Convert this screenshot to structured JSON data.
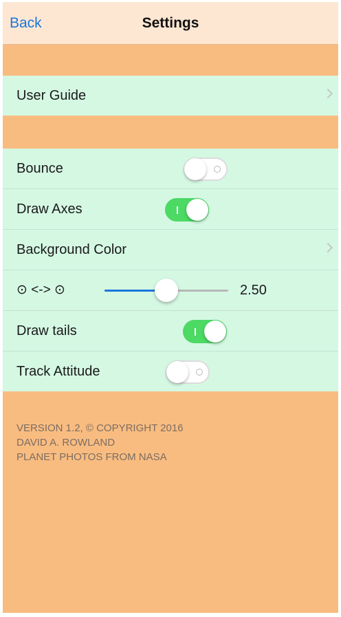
{
  "navbar": {
    "back_label": "Back",
    "title": "Settings"
  },
  "guide_group": {
    "user_guide_label": "User Guide"
  },
  "settings": {
    "bounce": {
      "label": "Bounce",
      "on": false
    },
    "draw_axes": {
      "label": "Draw Axes",
      "on": true
    },
    "background_color": {
      "label": "Background Color"
    },
    "scale": {
      "label": "⊙ <-> ⊙",
      "value_text": "2.50",
      "fraction": 0.5
    },
    "draw_tails": {
      "label": "Draw tails",
      "on": true
    },
    "track_attitude": {
      "label": "Track Attitude",
      "on": false
    }
  },
  "footer": {
    "line1": "VERSION 1.2, © COPYRIGHT 2016",
    "line2": "DAVID A. ROWLAND",
    "line3": "PLANET PHOTOS FROM NASA"
  },
  "colors": {
    "nav_background": "#fde7d3",
    "page_background": "#f9bc80",
    "cell_background": "#d5f8e3",
    "accent_blue": "#1a76db",
    "toggle_green": "#4cd964"
  }
}
